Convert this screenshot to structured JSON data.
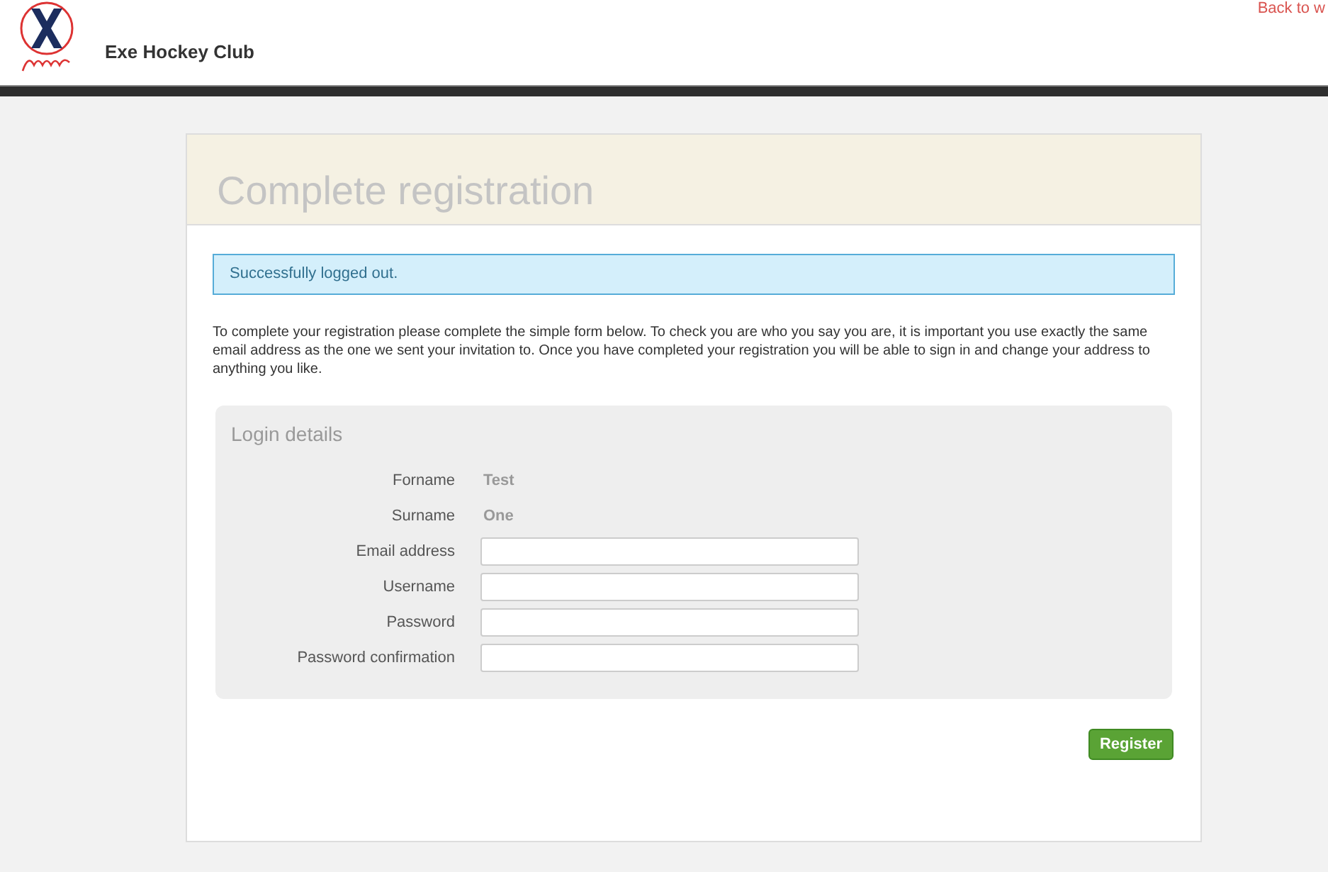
{
  "header": {
    "club_name": "Exe Hockey Club",
    "top_link": "Back to w"
  },
  "page": {
    "title": "Complete registration",
    "alert": "Successfully logged out.",
    "intro": "To complete your registration please complete the simple form below. To check you are who you say you are, it is important you use exactly the same email address as the one we sent your invitation to. Once you have completed your registration you will be able to sign in and change your address to anything you like."
  },
  "form": {
    "legend": "Login details",
    "fields": [
      {
        "kind": "static",
        "label": "Forname",
        "value": "Test"
      },
      {
        "kind": "static",
        "label": "Surname",
        "value": "One"
      },
      {
        "kind": "input",
        "label": "Email address"
      },
      {
        "kind": "input",
        "label": "Username"
      },
      {
        "kind": "input",
        "label": "Password"
      },
      {
        "kind": "input",
        "label": "Password confirmation"
      }
    ],
    "submit": "Register"
  }
}
